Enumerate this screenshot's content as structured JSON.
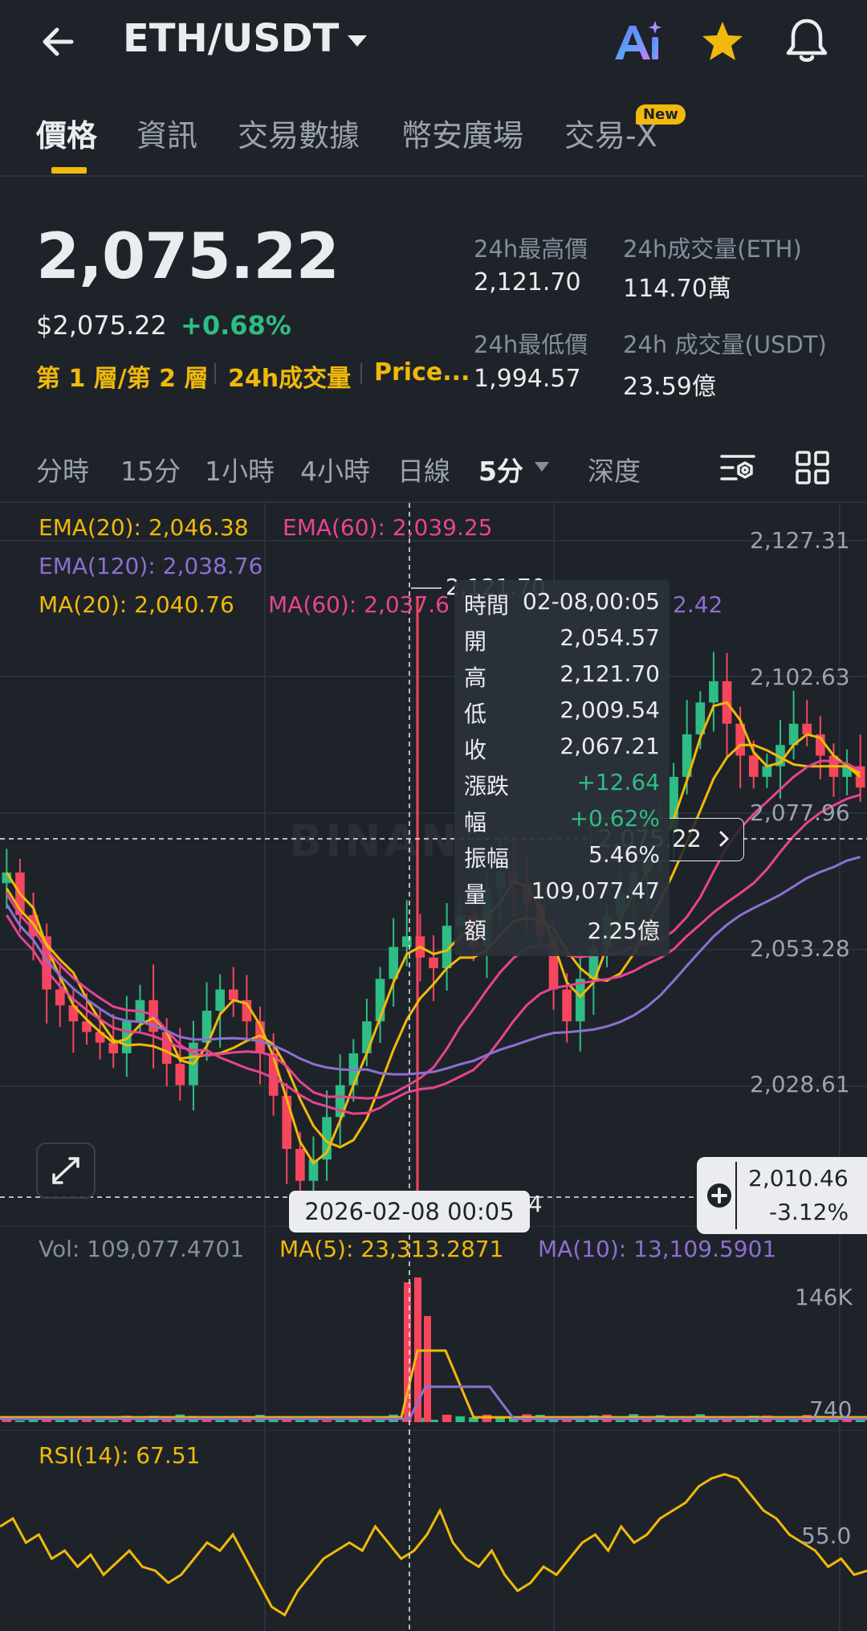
{
  "header": {
    "pair": "ETH/USDT",
    "ai_label": "Ai"
  },
  "tabs": [
    {
      "label": "價格",
      "active": true
    },
    {
      "label": "資訊"
    },
    {
      "label": "交易數據"
    },
    {
      "label": "幣安廣場"
    },
    {
      "label": "交易-X",
      "badge": "New"
    }
  ],
  "price": {
    "last": "2,075.22",
    "usd": "$2,075.22",
    "change_pct": "+0.68%",
    "links": [
      "第 1 層/第 2 層",
      "24h成交量",
      "Price..."
    ]
  },
  "stats": {
    "high_label": "24h最高價",
    "high_value": "2,121.70",
    "vol_eth_label": "24h成交量(ETH)",
    "vol_eth_value": "114.70萬",
    "low_label": "24h最低價",
    "low_value": "1,994.57",
    "vol_usdt_label": "24h 成交量(USDT)",
    "vol_usdt_value": "23.59億"
  },
  "intervals": [
    "分時",
    "15分",
    "1小時",
    "4小時",
    "日線",
    "5分",
    "深度"
  ],
  "active_interval": "5分",
  "indicators": {
    "ema20": "EMA(20): 2,046.38",
    "ema60": "EMA(60): 2,039.25",
    "ema120": "EMA(120): 2,038.76",
    "ma20": "MA(20): 2,040.76",
    "ma60": "MA(60): 2,037.6",
    "ma120_tail": "2.42",
    "vol": "Vol: 109,077.4701",
    "vol_ma5": "MA(5): 23,313.2871",
    "vol_ma10": "MA(10): 13,109.5901",
    "rsi": "RSI(14): 67.51"
  },
  "axis": {
    "price_ticks": [
      "2,127.31",
      "2,102.63",
      "2,077.96",
      "2,053.28",
      "2,028.61"
    ],
    "vol_ticks": [
      "146K",
      "740"
    ],
    "rsi_tick": "55.0",
    "high_marker": "2,121.70",
    "low_marker_tail": "54"
  },
  "tooltip": {
    "rows": [
      {
        "k": "時間",
        "v": "02-08,00:05"
      },
      {
        "k": "開",
        "v": "2,054.57"
      },
      {
        "k": "高",
        "v": "2,121.70"
      },
      {
        "k": "低",
        "v": "2,009.54"
      },
      {
        "k": "收",
        "v": "2,067.21"
      },
      {
        "k": "漲跌",
        "v": "+12.64",
        "color": "#2ebd85"
      },
      {
        "k": "幅",
        "v": "+0.62%",
        "color": "#2ebd85"
      },
      {
        "k": "振幅",
        "v": "5.46%"
      },
      {
        "k": "量",
        "v": "109,077.47"
      },
      {
        "k": "額",
        "v": "2.25億"
      }
    ]
  },
  "current_price_tag": "2,075.22",
  "crosshair_date": "2026-02-08 00:05",
  "crosshair_price": {
    "price": "2,010.46",
    "pct": "-3.12%"
  },
  "watermark": "BINANCE",
  "colors": {
    "bg": "#1e2329",
    "up": "#2ebd85",
    "down": "#f6465d",
    "yellow": "#f0b90b",
    "pink": "#e84393",
    "purple": "#8e6fd1",
    "ma20": "#f0b90b"
  },
  "chart_data": {
    "type": "candlestick",
    "price_range": [
      2005,
      2135
    ],
    "candles_close_trend": [
      2070,
      2062,
      2058,
      2048,
      2045,
      2042,
      2040,
      2038,
      2036,
      2042,
      2046,
      2040,
      2034,
      2030,
      2038,
      2044,
      2048,
      2046,
      2042,
      2036,
      2028,
      2018,
      2012,
      2016,
      2024,
      2030,
      2036,
      2042,
      2050,
      2056,
      2058,
      2054,
      2052,
      2060,
      2062,
      2056,
      2067,
      2070,
      2068,
      2064,
      2058,
      2048,
      2042,
      2050,
      2056,
      2062,
      2066,
      2070,
      2074,
      2078,
      2088,
      2096,
      2102,
      2106,
      2098,
      2092,
      2088,
      2090,
      2094,
      2098,
      2096,
      2092,
      2088,
      2090,
      2086
    ]
  }
}
